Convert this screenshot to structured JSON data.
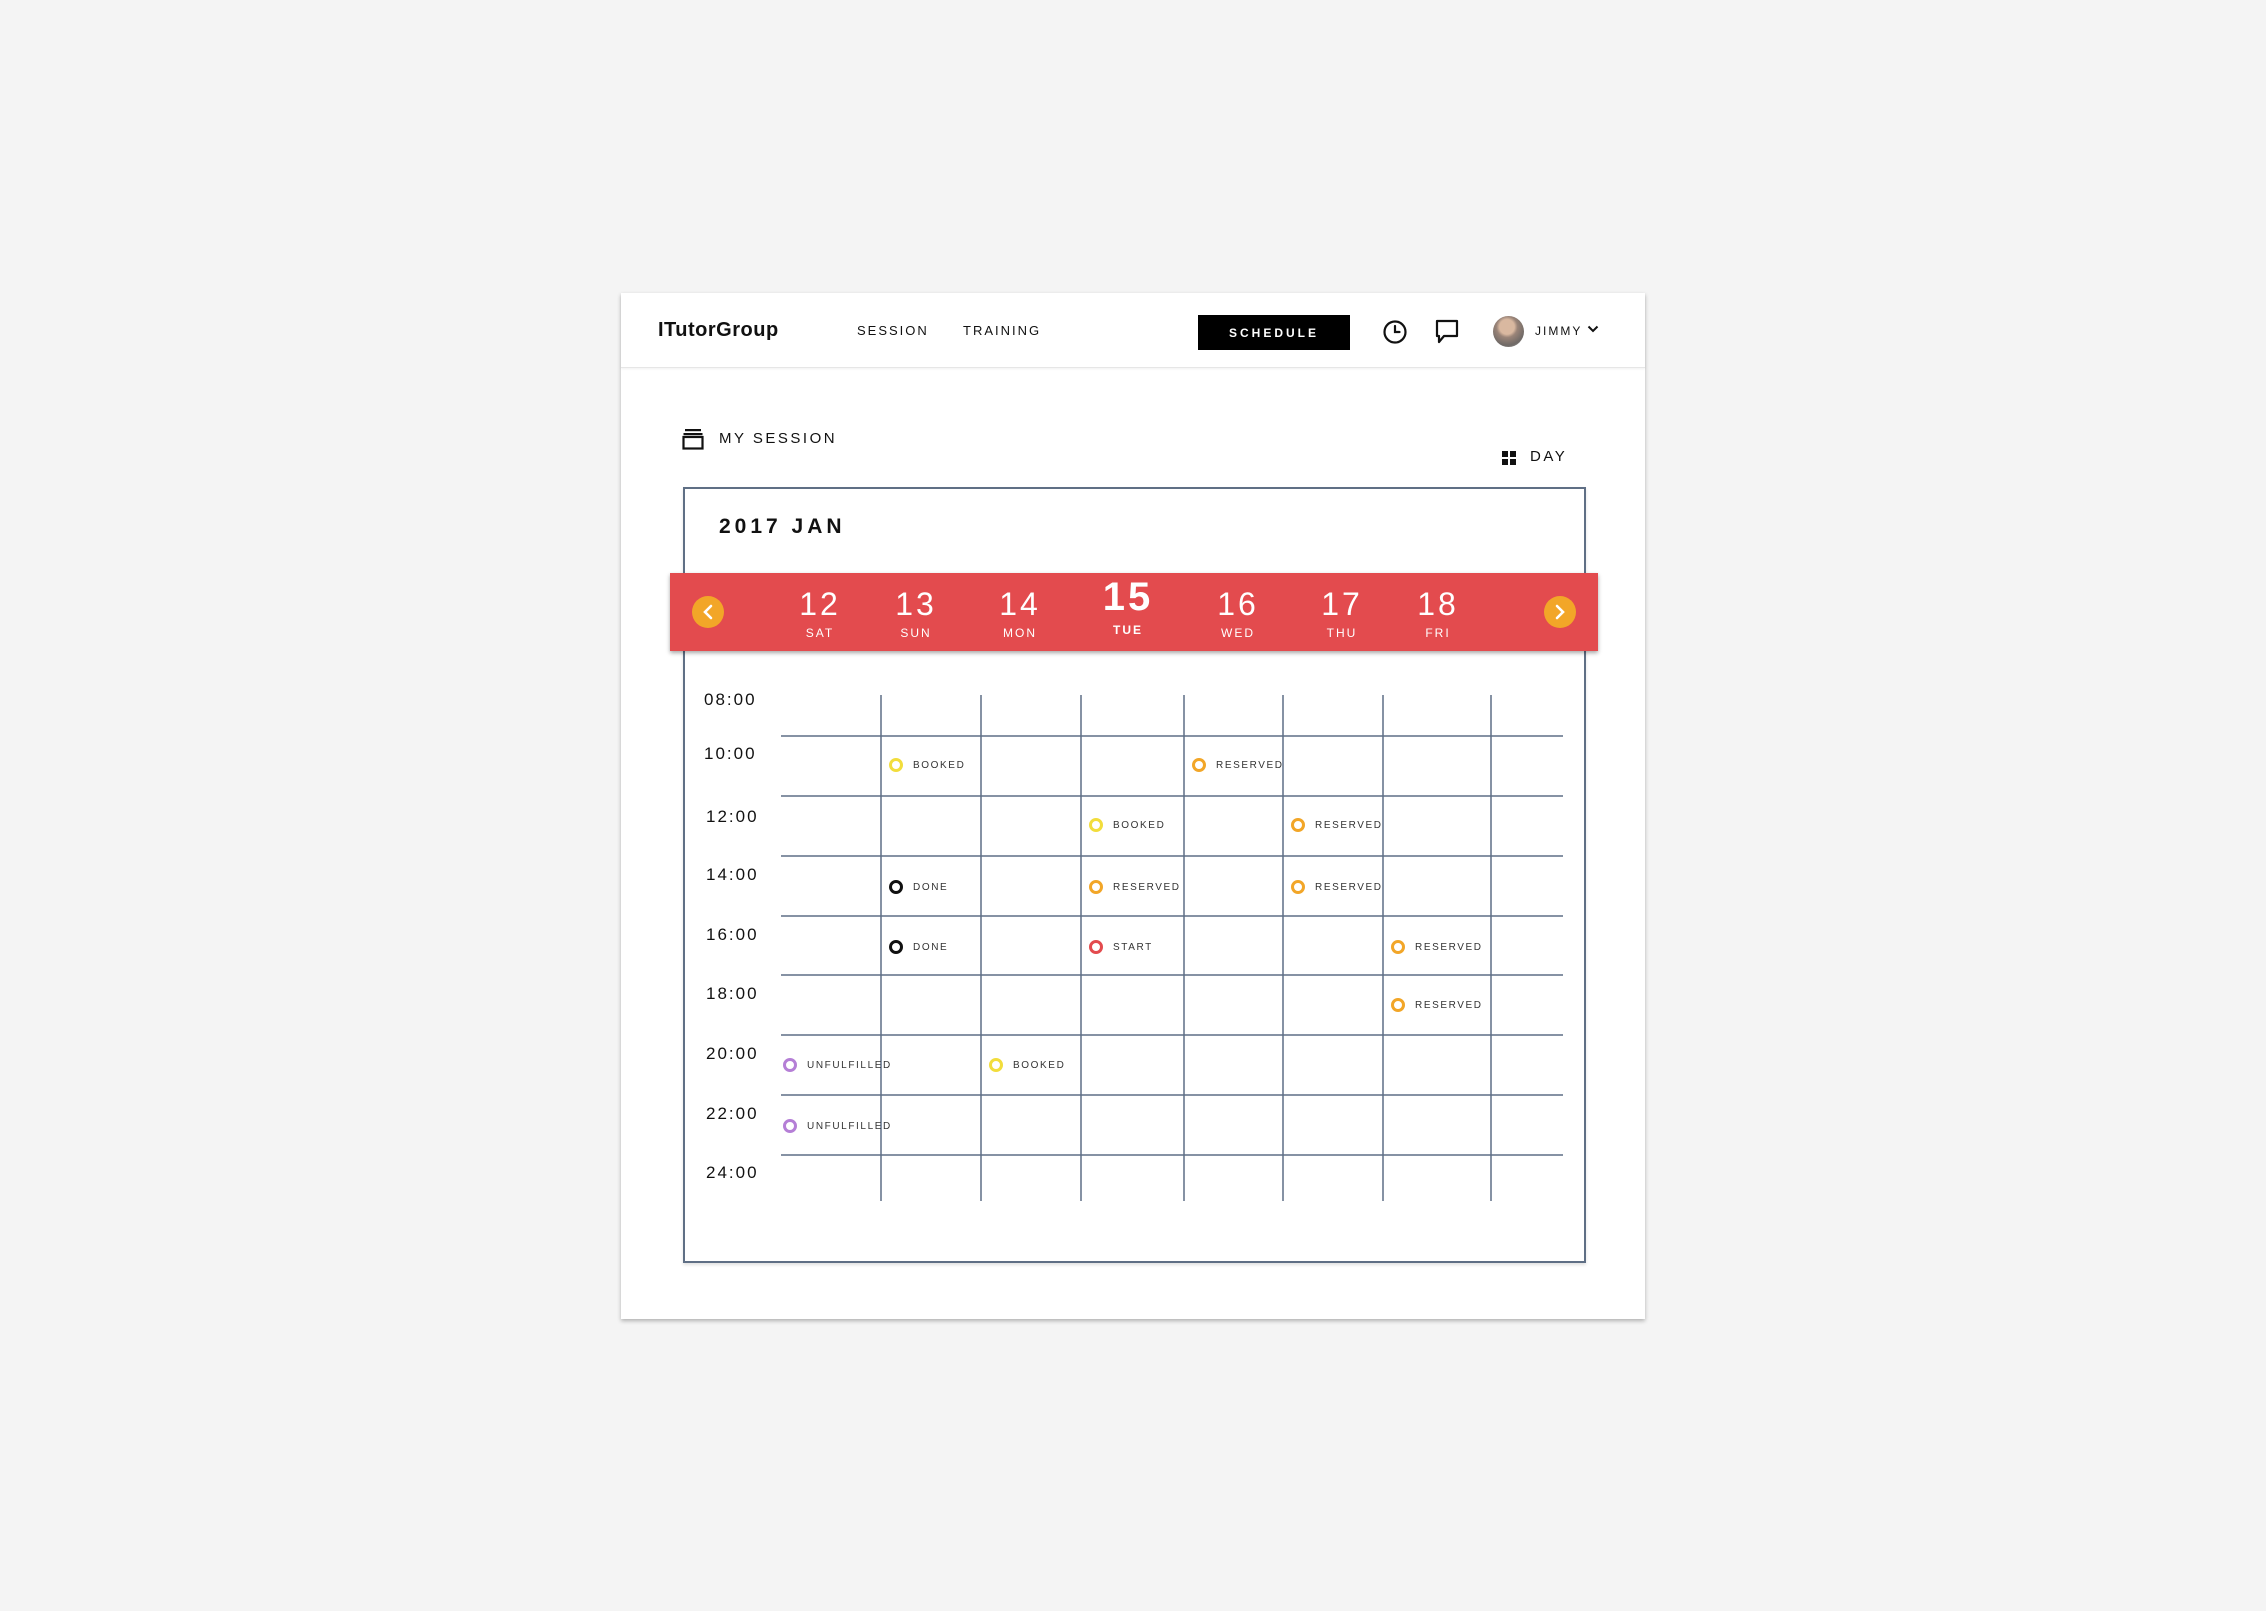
{
  "app": {
    "logo": "ITutorGroup",
    "nav": [
      "SESSION",
      "TRAINING"
    ],
    "schedule_label": "SCHEDULE",
    "user_name": "JIMMY"
  },
  "section": {
    "title": "MY SESSION",
    "view_label": "DAY"
  },
  "calendar": {
    "month_label": "2017 JAN",
    "days": [
      {
        "num": "12",
        "name": "SAT"
      },
      {
        "num": "13",
        "name": "SUN"
      },
      {
        "num": "14",
        "name": "MON"
      },
      {
        "num": "15",
        "name": "TUE",
        "active": true
      },
      {
        "num": "16",
        "name": "WED"
      },
      {
        "num": "17",
        "name": "THU"
      },
      {
        "num": "18",
        "name": "FRI"
      }
    ],
    "times": [
      "08:00",
      "10:00",
      "12:00",
      "14:00",
      "16:00",
      "18:00",
      "20:00",
      "22:00",
      "24:00"
    ],
    "status_colors": {
      "BOOKED": "#f2dd3c",
      "RESERVED": "#f2a628",
      "DONE": "#111111",
      "START": "#e34b4e",
      "UNFULFILLED": "#b57fd6"
    },
    "events": [
      {
        "col": 0,
        "row": 6,
        "status": "UNFULFILLED"
      },
      {
        "col": 0,
        "row": 7,
        "status": "UNFULFILLED"
      },
      {
        "col": 1,
        "row": 1,
        "status": "BOOKED"
      },
      {
        "col": 1,
        "row": 3,
        "status": "DONE"
      },
      {
        "col": 1,
        "row": 4,
        "status": "DONE"
      },
      {
        "col": 2,
        "row": 6,
        "status": "BOOKED"
      },
      {
        "col": 3,
        "row": 2,
        "status": "BOOKED"
      },
      {
        "col": 3,
        "row": 3,
        "status": "RESERVED"
      },
      {
        "col": 3,
        "row": 4,
        "status": "START"
      },
      {
        "col": 4,
        "row": 1,
        "status": "RESERVED"
      },
      {
        "col": 5,
        "row": 2,
        "status": "RESERVED"
      },
      {
        "col": 5,
        "row": 3,
        "status": "RESERVED"
      },
      {
        "col": 6,
        "row": 4,
        "status": "RESERVED"
      },
      {
        "col": 6,
        "row": 5,
        "status": "RESERVED"
      }
    ]
  }
}
